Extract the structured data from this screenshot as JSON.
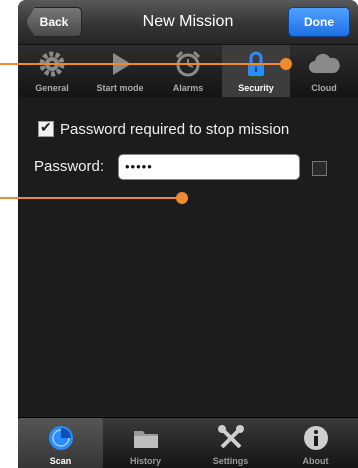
{
  "navbar": {
    "title": "New Mission",
    "back_label": "Back",
    "done_label": "Done"
  },
  "top_tabs": [
    {
      "label": "General",
      "icon": "gear-icon",
      "active": false
    },
    {
      "label": "Start mode",
      "icon": "play-icon",
      "active": false
    },
    {
      "label": "Alarms",
      "icon": "alarm-clock-icon",
      "active": false
    },
    {
      "label": "Security",
      "icon": "lock-icon",
      "active": true
    },
    {
      "label": "Cloud",
      "icon": "cloud-icon",
      "active": false
    }
  ],
  "security": {
    "password_required_label": "Password required to stop mission",
    "password_required_checked": true,
    "password_label": "Password:",
    "password_value": "•••••",
    "show_password_checked": false
  },
  "bottom_tabs": [
    {
      "label": "Scan",
      "icon": "scan-icon",
      "active": true
    },
    {
      "label": "History",
      "icon": "folder-icon",
      "active": false
    },
    {
      "label": "Settings",
      "icon": "tools-icon",
      "active": false
    },
    {
      "label": "About",
      "icon": "info-icon",
      "active": false
    }
  ],
  "colors": {
    "accent": "#1f6fe6",
    "callout": "#f08a30",
    "background": "#1c1c1c"
  }
}
